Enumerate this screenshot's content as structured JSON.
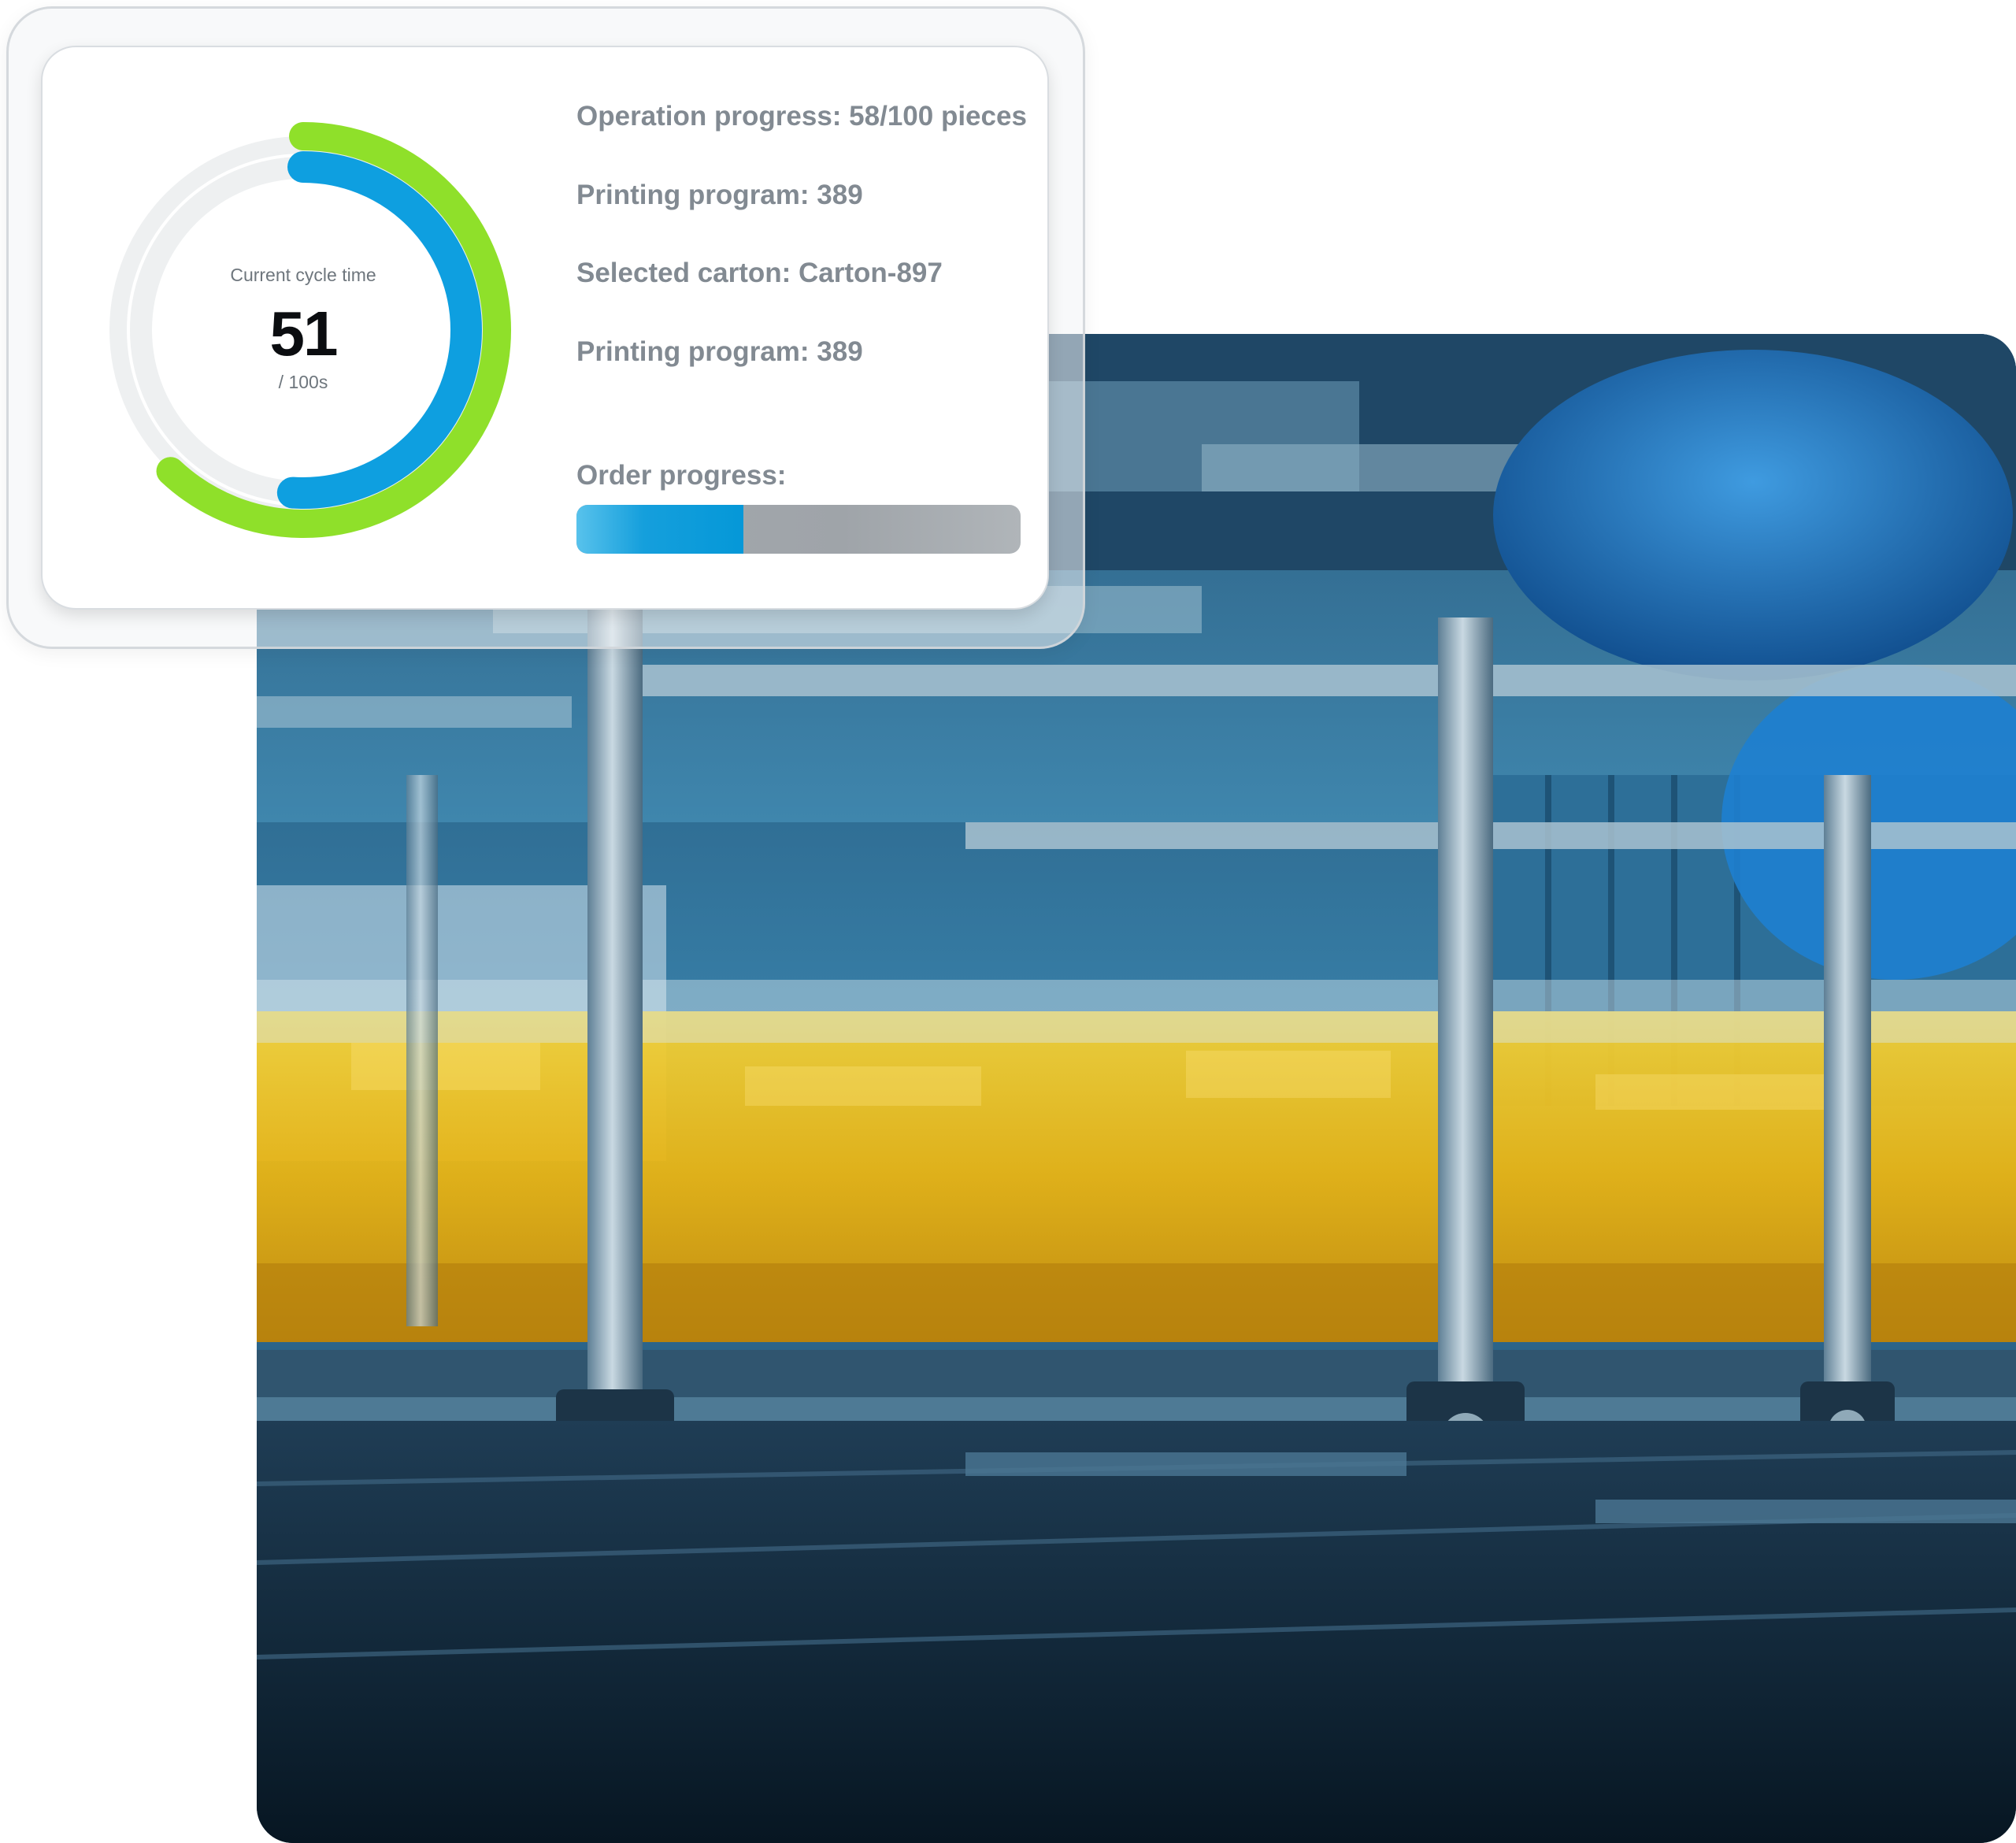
{
  "cycle_gauge": {
    "label": "Current cycle time",
    "value": "51",
    "unit": "/ 100s",
    "fraction": 0.51,
    "outer_fraction": 0.62,
    "colors": {
      "track": "#eef0f1",
      "outer_arc": "#8fe02a",
      "inner_arc": "#0e9fe0"
    }
  },
  "info": {
    "operation_progress": "Operation progress: 58/100 pieces",
    "printing_program_1": "Printing program: 389",
    "selected_carton": "Selected carton: Carton-897",
    "printing_program_2": "Printing program: 389",
    "order_progress_label": "Order progress:"
  },
  "order_progress": {
    "fraction": 0.375,
    "fill_color": "#0598d8",
    "track_color": "#a3a8ad"
  },
  "photo": {
    "icon": "factory-bottling-line-photo"
  }
}
